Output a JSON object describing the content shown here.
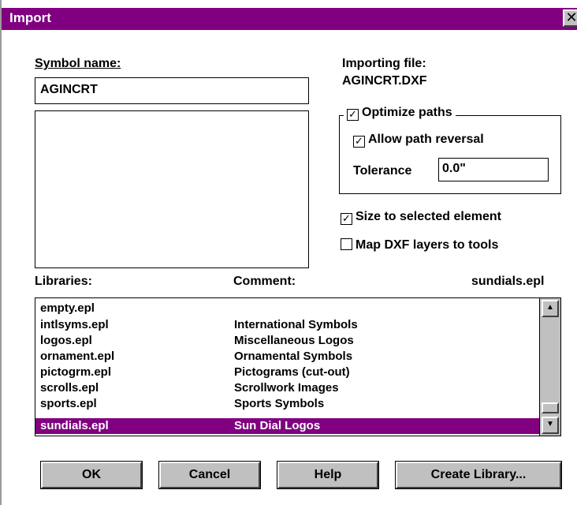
{
  "window": {
    "title": "Import",
    "close_glyph": "✕"
  },
  "symbol_name": {
    "label": "Symbol name:",
    "value": "AGINCRT"
  },
  "importing": {
    "label": "Importing file:",
    "file": "AGINCRT.DXF"
  },
  "options": {
    "optimize_paths": {
      "label": "Optimize paths",
      "checked": true
    },
    "allow_path_reversal": {
      "label": "Allow path reversal",
      "checked": true
    },
    "tolerance": {
      "label": "Tolerance",
      "value": "0.0\""
    },
    "size_to_selected": {
      "label": "Size to selected element",
      "checked": true
    },
    "map_dxf_layers": {
      "label": "Map DXF layers to tools",
      "checked": false
    }
  },
  "libraries": {
    "label": "Libraries:",
    "comment_label": "Comment:",
    "current": "sundials.epl",
    "rows": [
      {
        "name": "empty.epl",
        "comment": ""
      },
      {
        "name": "intlsyms.epl",
        "comment": "International Symbols"
      },
      {
        "name": "logos.epl",
        "comment": "Miscellaneous Logos"
      },
      {
        "name": "ornament.epl",
        "comment": "Ornamental Symbols"
      },
      {
        "name": "pictogrm.epl",
        "comment": "Pictograms (cut-out)"
      },
      {
        "name": "scrolls.epl",
        "comment": "Scrollwork Images"
      },
      {
        "name": "sports.epl",
        "comment": "Sports Symbols"
      },
      {
        "name": "sundials.epl",
        "comment": "Sun Dial Logos"
      }
    ],
    "selected_index": 7
  },
  "buttons": {
    "ok": "OK",
    "cancel": "Cancel",
    "help": "Help",
    "create_library": "Create Library..."
  },
  "colors": {
    "title_bar": "#800080",
    "selection": "#800080",
    "face": "#c0c0c0"
  }
}
